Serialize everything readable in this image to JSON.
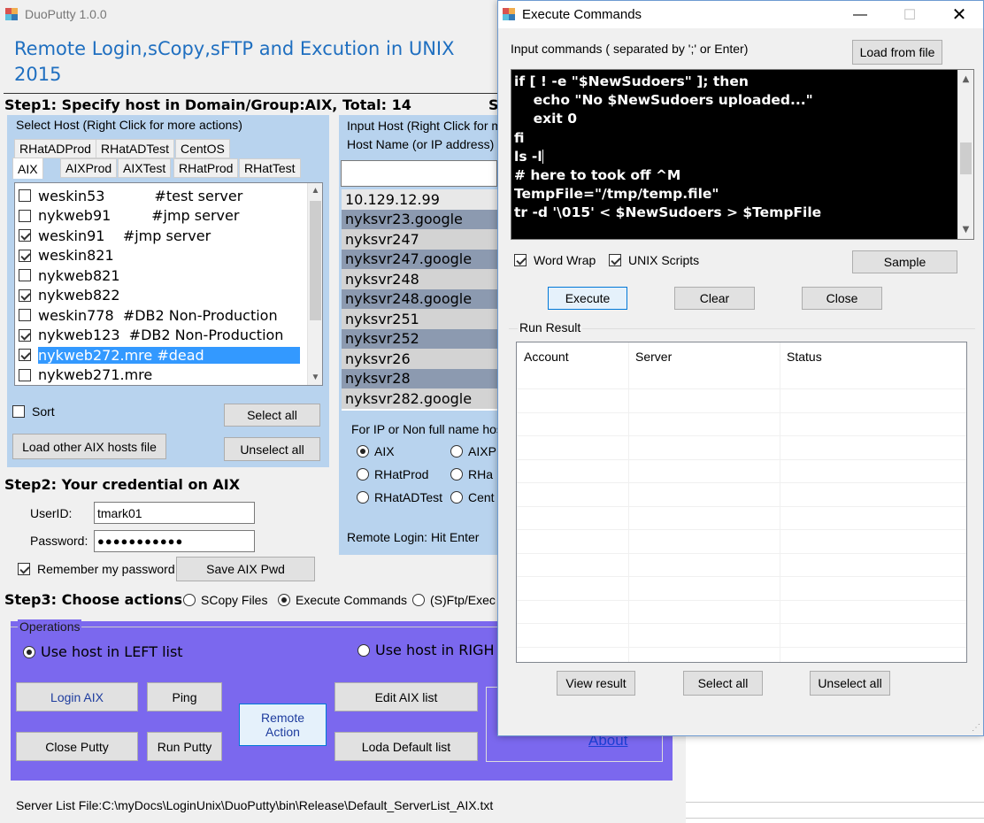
{
  "main": {
    "title": "DuoPutty 1.0.0",
    "heading_line1": "Remote Login,sCopy,sFTP and Excution in UNIX",
    "heading_line2": "2015",
    "step1": "Step1: Specify host in Domain/Group:AIX, Total: 14",
    "step1_right": "S",
    "select_host_label": "Select Host (Right Click for more actions)",
    "tabs_row1": [
      "RHatADProd",
      "RHatADTest",
      "CentOS"
    ],
    "tabs_row2": [
      "AIX",
      "AIXProd",
      "AIXTest",
      "RHatProd",
      "RHatTest"
    ],
    "hosts": [
      {
        "text": "weskin53           #test server",
        "checked": false
      },
      {
        "text": "nykweb91         #jmp server",
        "checked": false
      },
      {
        "text": "weskin91    #jmp server",
        "checked": true
      },
      {
        "text": "weskin821",
        "checked": true
      },
      {
        "text": "nykweb821",
        "checked": false
      },
      {
        "text": "nykweb822",
        "checked": true
      },
      {
        "text": "weskin778  #DB2 Non-Production",
        "checked": false
      },
      {
        "text": "nykweb123  #DB2 Non-Production",
        "checked": true
      },
      {
        "text": "nykweb272.mre #dead",
        "checked": true
      },
      {
        "text": "nykweb271.mre",
        "checked": false
      }
    ],
    "sort_label": "Sort",
    "select_all": "Select all",
    "unselect_all": "Unselect all",
    "load_other": "Load other AIX hosts file",
    "input_host_label": "Input Host (Right Click for mo",
    "host_name_label": "Host Name (or IP address)",
    "host_input_value": "",
    "right_hosts": [
      "10.129.12.99",
      "nyksvr23.google",
      "nyksvr247",
      "nyksvr247.google",
      "nyksvr248",
      "nyksvr248.google",
      "nyksvr251",
      "nyksvr252",
      "nyksvr26",
      "nyksvr28",
      "nyksvr282.google"
    ],
    "for_ip_label": "For IP or Non full name host",
    "radio_groups": [
      [
        {
          "label": "AIX",
          "on": true
        },
        {
          "label": "AIXP",
          "on": false
        }
      ],
      [
        {
          "label": "RHatProd",
          "on": false
        },
        {
          "label": "RHa",
          "on": false
        }
      ],
      [
        {
          "label": "RHatADTest",
          "on": false
        },
        {
          "label": "Cent",
          "on": false
        }
      ]
    ],
    "remote_login_hint": "Remote Login: Hit Enter",
    "step2": "Step2: Your credential on AIX",
    "userid_label": "UserID:",
    "userid_value": "tmark01",
    "password_label": "Password:",
    "password_value": "●●●●●●●●●●●",
    "remember_label": "Remember my password",
    "save_pwd": "Save AIX Pwd",
    "step3": "Step3: Choose actions",
    "action_scopy": "SCopy Files",
    "action_execute": "Execute Commands",
    "action_sftp": "(S)Ftp/Exec",
    "operations_legend": "Operations",
    "use_left": "Use host in LEFT list",
    "use_right": "Use host in RIGH",
    "login_aix": "Login AIX",
    "ping": "Ping",
    "remote_action": "Remote Action",
    "edit_aix_list": "Edit AIX list",
    "close_putty": "Close Putty",
    "run_putty": "Run Putty",
    "loda_default": "Loda Default list",
    "about": "About",
    "server_list_file": "Server List File:C:\\myDocs\\LoginUnix\\DuoPutty\\bin\\Release\\Default_ServerList_AIX.txt"
  },
  "exec": {
    "title": "Execute Commands",
    "input_label": "Input commands ( separated  by ';' or Enter)",
    "load_from_file": "Load from file",
    "code_lines": [
      "if [ ! -e \"$NewSudoers\" ]; then",
      "    echo \"No $NewSudoers uploaded...\"",
      "    exit 0",
      "fi",
      "ls -l",
      "# here to took off ^M",
      "TempFile=\"/tmp/temp.file\"",
      "tr -d '\\015' < $NewSudoers > $TempFile"
    ],
    "word_wrap": "Word Wrap",
    "unix_scripts": "UNIX Scripts",
    "sample": "Sample",
    "execute": "Execute",
    "clear": "Clear",
    "close": "Close",
    "run_result": "Run Result",
    "col_account": "Account",
    "col_server": "Server",
    "col_status": "Status",
    "view_result": "View result",
    "select_all": "Select all",
    "unselect_all": "Unselect all"
  }
}
